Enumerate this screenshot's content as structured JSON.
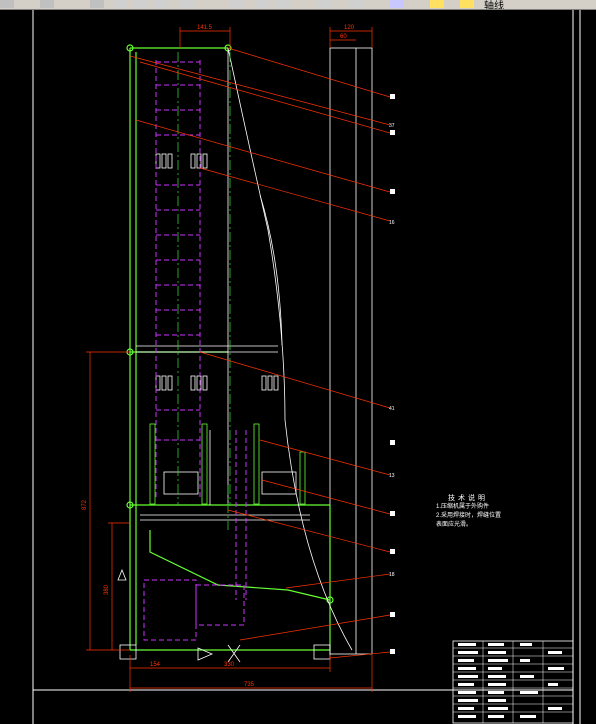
{
  "toolbar": {
    "layer_label": "轴线"
  },
  "dimensions": {
    "top_width": "141.5",
    "top_right_1": "120",
    "top_right_2": "60",
    "left_height": "872",
    "left_lower": "380",
    "bottom_left": "154",
    "bottom_mid": "330",
    "bottom_total": "735"
  },
  "leaders": {
    "l1": "37",
    "l2": "16",
    "l3": "41",
    "l4": "13",
    "l5": "18"
  },
  "notes": {
    "title": "技术说明",
    "line1": "1.压缩机属于外购件",
    "line2": "2.采用焊接时，焊缝位置",
    "line3": "表面应光滑。"
  },
  "colors": {
    "background": "#000000",
    "frame": "#ffffff",
    "outline": "#66ff33",
    "hidden": "#cc33ff",
    "centerline": "#33cc33",
    "leader": "#ff3300",
    "dimension": "#ff3300"
  }
}
